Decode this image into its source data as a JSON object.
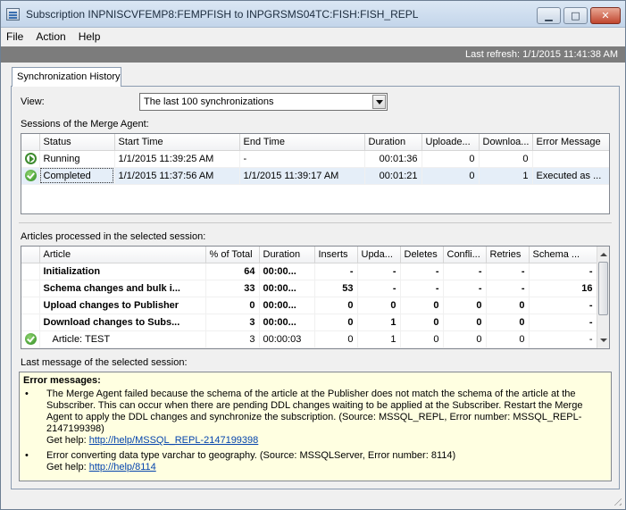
{
  "window": {
    "title": "Subscription INPNISCVFEMP8:FEMPFISH to INPGRSMS04TC:FISH:FISH_REPL",
    "controls": {
      "minimize": "▁",
      "maximize": "□",
      "close": "✕"
    }
  },
  "menu": [
    "File",
    "Action",
    "Help"
  ],
  "refresh": "Last refresh: 1/1/2015 11:41:38 AM",
  "tab": "Synchronization History",
  "view": {
    "label": "View:",
    "value": "The last 100 synchronizations"
  },
  "sessions": {
    "label": "Sessions of the Merge Agent:",
    "columns": [
      "",
      "Status",
      "Start Time",
      "End Time",
      "Duration",
      "Uploade...",
      "Downloa...",
      "Error Message"
    ],
    "rows": [
      {
        "icon": "running-icon",
        "status": "Running",
        "start": "1/1/2015 11:39:25 AM",
        "end": "-",
        "duration": "00:01:36",
        "uploaded": "0",
        "downloaded": "0",
        "error": ""
      },
      {
        "icon": "completed-icon",
        "status": "Completed",
        "start": "1/1/2015 11:37:56 AM",
        "end": "1/1/2015 11:39:17 AM",
        "duration": "00:01:21",
        "uploaded": "0",
        "downloaded": "1",
        "error": "Executed as ..."
      }
    ]
  },
  "articles": {
    "label": "Articles processed in the selected session:",
    "columns": [
      "",
      "Article",
      "% of Total",
      "Duration",
      "Inserts",
      "Upda...",
      "Deletes",
      "Confli...",
      "Retries",
      "Schema ..."
    ],
    "rows": [
      {
        "icon": "",
        "article": "Initialization",
        "pct": "64",
        "duration": "00:00...",
        "inserts": "-",
        "updates": "-",
        "deletes": "-",
        "conflicts": "-",
        "retries": "-",
        "schema": "-",
        "bold": true
      },
      {
        "icon": "",
        "article": "Schema changes and bulk i...",
        "pct": "33",
        "duration": "00:00...",
        "inserts": "53",
        "updates": "-",
        "deletes": "-",
        "conflicts": "-",
        "retries": "-",
        "schema": "16",
        "bold": true
      },
      {
        "icon": "",
        "article": "Upload changes to Publisher",
        "pct": "0",
        "duration": "00:00...",
        "inserts": "0",
        "updates": "0",
        "deletes": "0",
        "conflicts": "0",
        "retries": "0",
        "schema": "-",
        "bold": true
      },
      {
        "icon": "",
        "article": "Download changes to Subs...",
        "pct": "3",
        "duration": "00:00...",
        "inserts": "0",
        "updates": "1",
        "deletes": "0",
        "conflicts": "0",
        "retries": "0",
        "schema": "-",
        "bold": true
      },
      {
        "icon": "completed-icon",
        "article": "Article: TEST",
        "pct": "3",
        "duration": "00:00:03",
        "inserts": "0",
        "updates": "1",
        "deletes": "0",
        "conflicts": "0",
        "retries": "0",
        "schema": "-",
        "bold": false
      }
    ]
  },
  "message": {
    "label": "Last message of the selected session:",
    "header": "Error messages:",
    "items": [
      {
        "text": "The Merge Agent failed because the schema of the article at the Publisher does not match the schema of the article at the Subscriber. This can occur when there are pending DDL changes waiting to be applied at the Subscriber. Restart the Merge Agent to apply the DDL changes and synchronize the subscription.  (Source: MSSQL_REPL, Error number: MSSQL_REPL-2147199398)",
        "help_label": "Get help:",
        "help_link": "http://help/MSSQL_REPL-2147199398"
      },
      {
        "text": "Error converting data type varchar to geography. (Source: MSSQLServer, Error number: 8114)",
        "help_label": "Get help:",
        "help_link": "http://help/8114"
      }
    ]
  }
}
